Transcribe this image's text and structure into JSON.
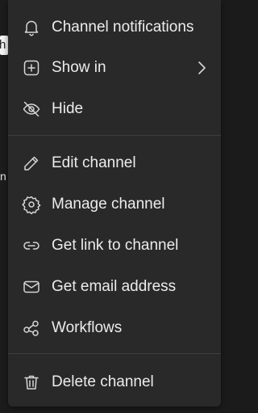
{
  "menu": {
    "items": [
      {
        "label": "Channel notifications",
        "icon": "bell-icon"
      },
      {
        "label": "Show in",
        "icon": "plus-square-icon",
        "has_submenu": true
      },
      {
        "label": "Hide",
        "icon": "eye-off-icon"
      },
      {
        "label": "Edit channel",
        "icon": "pencil-icon"
      },
      {
        "label": "Manage channel",
        "icon": "gear-icon"
      },
      {
        "label": "Get link to channel",
        "icon": "link-icon"
      },
      {
        "label": "Get email address",
        "icon": "mail-icon"
      },
      {
        "label": "Workflows",
        "icon": "workflow-icon"
      },
      {
        "label": "Delete channel",
        "icon": "trash-icon"
      }
    ]
  },
  "backdrop": {
    "edge_text": "h",
    "side_char": "n"
  },
  "colors": {
    "menu_bg": "#292929",
    "text": "#ececec",
    "icon": "#d6d6d6",
    "divider": "#3d3d3d"
  }
}
